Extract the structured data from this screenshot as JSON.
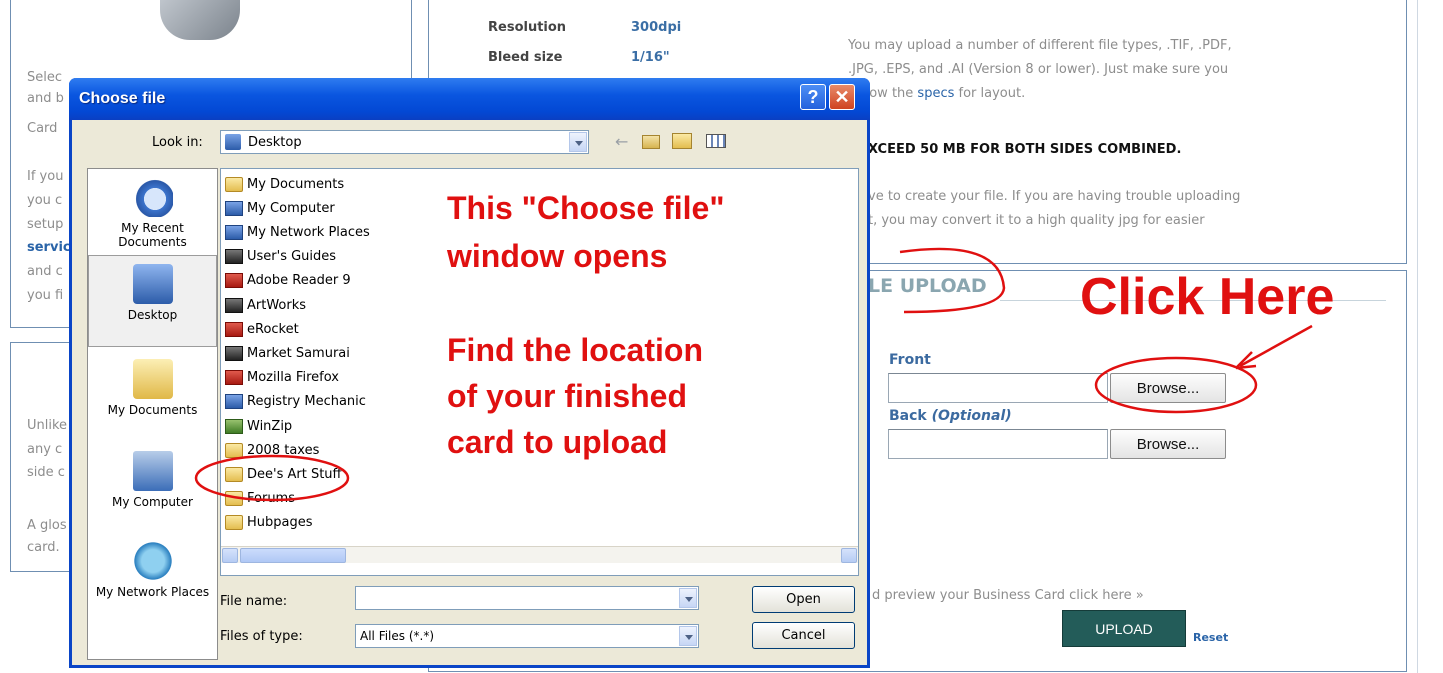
{
  "specs": {
    "resolution_label": "Resolution",
    "resolution_value": "300dpi",
    "bleed_label": "Bleed size",
    "bleed_value": "1/16\""
  },
  "right_info": {
    "line1": "You may upload a number of different file types, .TIF, .PDF,",
    "line2": ".JPG, .EPS, and .AI (Version 8 or lower). Just make sure you",
    "line3_pre": "llow the ",
    "line3_link": "specs",
    "line3_post": " for layout.",
    "warning": "XCEED 50 MB FOR BOTH SIDES COMBINED.",
    "line5": "ve to create your file. If you are having trouble uploading",
    "line6": "t, you may convert it to a high quality jpg for easier"
  },
  "left_partial": {
    "lines": [
      "Selec",
      "and b",
      "Card",
      "If you",
      "you c",
      "setup",
      "servic",
      "and c",
      "you fi"
    ],
    "lines2": [
      "Unlike",
      "any c",
      "side c",
      "A glos",
      "card."
    ]
  },
  "upload_section": {
    "title": "LE UPLOAD",
    "front_label": "Front",
    "back_label": "Back",
    "back_optional": "(Optional)",
    "browse_label": "Browse...",
    "preview_text": "d preview your Business Card click here »",
    "upload_button": "UPLOAD",
    "reset_link": "Reset"
  },
  "dialog": {
    "title": "Choose file",
    "help_glyph": "?",
    "close_glyph": "✕",
    "look_in_label": "Look in:",
    "look_in_value": "Desktop",
    "places": [
      "My Recent Documents",
      "Desktop",
      "My Documents",
      "My Computer",
      "My Network Places"
    ],
    "files": [
      {
        "name": "My Documents",
        "icon": "folder"
      },
      {
        "name": "My Computer",
        "icon": "app"
      },
      {
        "name": "My Network Places",
        "icon": "app"
      },
      {
        "name": "User's Guides",
        "icon": "dark"
      },
      {
        "name": "Adobe Reader 9",
        "icon": "red"
      },
      {
        "name": "ArtWorks",
        "icon": "dark"
      },
      {
        "name": "eRocket",
        "icon": "red"
      },
      {
        "name": "Market Samurai",
        "icon": "dark"
      },
      {
        "name": "Mozilla Firefox",
        "icon": "red"
      },
      {
        "name": "Registry Mechanic",
        "icon": "app"
      },
      {
        "name": "WinZip",
        "icon": "green"
      },
      {
        "name": "2008 taxes",
        "icon": "folder"
      },
      {
        "name": "Dee's Art Stuff",
        "icon": "folder"
      },
      {
        "name": "Forums",
        "icon": "folder"
      },
      {
        "name": "Hubpages",
        "icon": "folder"
      }
    ],
    "file_name_label": "File name:",
    "file_name_value": "",
    "files_of_type_label": "Files of type:",
    "files_of_type_value": "All Files (*.*)",
    "open_button": "Open",
    "cancel_button": "Cancel"
  },
  "annotations": {
    "dialog_note_line1": "This \"Choose file\"",
    "dialog_note_line2": "window opens",
    "find_line1": "Find the location",
    "find_line2": "of your finished",
    "find_line3": "card to upload",
    "click_here": "Click Here"
  },
  "colors": {
    "annotation": "#e01010",
    "titlebar": "#0a56e0",
    "upload_button": "#235c59"
  }
}
